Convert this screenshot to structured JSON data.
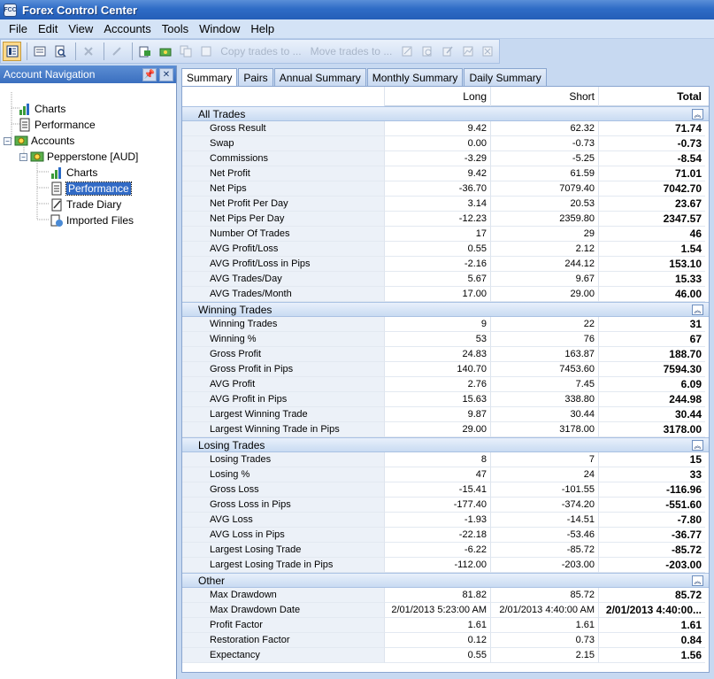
{
  "window": {
    "title": "Forex Control Center",
    "icon_text": "FCC"
  },
  "menu": [
    "File",
    "Edit",
    "View",
    "Accounts",
    "Tools",
    "Window",
    "Help"
  ],
  "toolbar": {
    "copy_trades_label": "Copy trades to ...",
    "move_trades_label": "Move trades to ..."
  },
  "nav": {
    "header": "Account Navigation",
    "items": [
      {
        "label": "Charts",
        "icon": "chart-icon"
      },
      {
        "label": "Performance",
        "icon": "document-icon"
      },
      {
        "label": "Accounts",
        "icon": "money-icon"
      },
      {
        "label": "Pepperstone [AUD]",
        "icon": "money-icon"
      },
      {
        "label": "Charts",
        "icon": "chart-icon"
      },
      {
        "label": "Performance",
        "icon": "document-icon"
      },
      {
        "label": "Trade Diary",
        "icon": "diary-icon"
      },
      {
        "label": "Imported Files",
        "icon": "import-icon"
      }
    ]
  },
  "tabs": [
    "Summary",
    "Pairs",
    "Annual Summary",
    "Monthly Summary",
    "Daily Summary"
  ],
  "grid": {
    "headers": {
      "label": "",
      "long": "Long",
      "short": "Short",
      "total": "Total"
    },
    "sections": [
      {
        "title": "All Trades",
        "rows": [
          [
            "Gross Result",
            "9.42",
            "62.32",
            "71.74"
          ],
          [
            "Swap",
            "0.00",
            "-0.73",
            "-0.73"
          ],
          [
            "Commissions",
            "-3.29",
            "-5.25",
            "-8.54"
          ],
          [
            "Net Profit",
            "9.42",
            "61.59",
            "71.01"
          ],
          [
            "Net Pips",
            "-36.70",
            "7079.40",
            "7042.70"
          ],
          [
            "Net Profit Per Day",
            "3.14",
            "20.53",
            "23.67"
          ],
          [
            "Net Pips Per Day",
            "-12.23",
            "2359.80",
            "2347.57"
          ],
          [
            "Number Of Trades",
            "17",
            "29",
            "46"
          ],
          [
            "AVG Profit/Loss",
            "0.55",
            "2.12",
            "1.54"
          ],
          [
            "AVG Profit/Loss in Pips",
            "-2.16",
            "244.12",
            "153.10"
          ],
          [
            "AVG Trades/Day",
            "5.67",
            "9.67",
            "15.33"
          ],
          [
            "AVG Trades/Month",
            "17.00",
            "29.00",
            "46.00"
          ]
        ]
      },
      {
        "title": "Winning Trades",
        "rows": [
          [
            "Winning Trades",
            "9",
            "22",
            "31"
          ],
          [
            "Winning %",
            "53",
            "76",
            "67"
          ],
          [
            "Gross Profit",
            "24.83",
            "163.87",
            "188.70"
          ],
          [
            "Gross Profit in Pips",
            "140.70",
            "7453.60",
            "7594.30"
          ],
          [
            "AVG Profit",
            "2.76",
            "7.45",
            "6.09"
          ],
          [
            "AVG Profit in Pips",
            "15.63",
            "338.80",
            "244.98"
          ],
          [
            "Largest Winning Trade",
            "9.87",
            "30.44",
            "30.44"
          ],
          [
            "Largest Winning Trade in Pips",
            "29.00",
            "3178.00",
            "3178.00"
          ]
        ]
      },
      {
        "title": "Losing Trades",
        "rows": [
          [
            "Losing Trades",
            "8",
            "7",
            "15"
          ],
          [
            "Losing %",
            "47",
            "24",
            "33"
          ],
          [
            "Gross Loss",
            "-15.41",
            "-101.55",
            "-116.96"
          ],
          [
            "Gross Loss in Pips",
            "-177.40",
            "-374.20",
            "-551.60"
          ],
          [
            "AVG Loss",
            "-1.93",
            "-14.51",
            "-7.80"
          ],
          [
            "AVG Loss in Pips",
            "-22.18",
            "-53.46",
            "-36.77"
          ],
          [
            "Largest Losing Trade",
            "-6.22",
            "-85.72",
            "-85.72"
          ],
          [
            "Largest Losing Trade in Pips",
            "-112.00",
            "-203.00",
            "-203.00"
          ]
        ]
      },
      {
        "title": "Other",
        "rows": [
          [
            "Max Drawdown",
            "81.82",
            "85.72",
            "85.72"
          ],
          [
            "Max Drawdown Date",
            "2/01/2013 5:23:00 AM",
            "2/01/2013 4:40:00 AM",
            "2/01/2013 4:40:00..."
          ],
          [
            "Profit Factor",
            "1.61",
            "1.61",
            "1.61"
          ],
          [
            "Restoration Factor",
            "0.12",
            "0.73",
            "0.84"
          ],
          [
            "Expectancy",
            "0.55",
            "2.15",
            "1.56"
          ]
        ]
      }
    ]
  }
}
